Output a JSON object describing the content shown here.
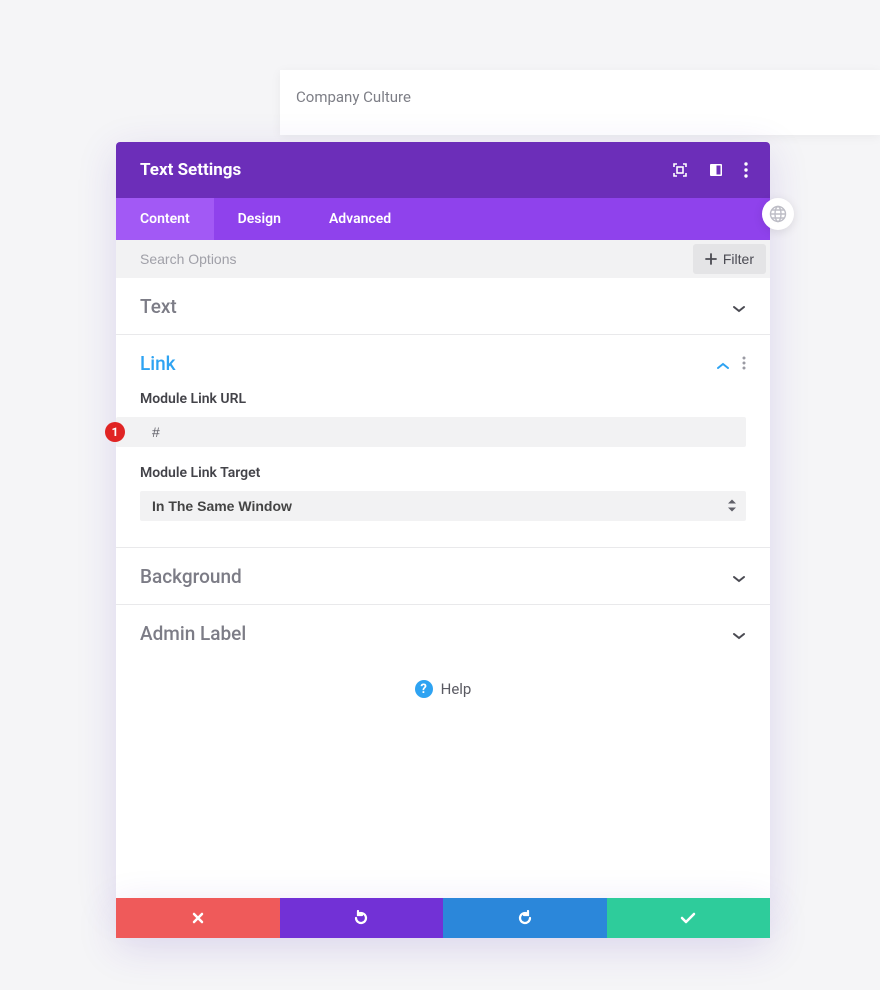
{
  "companyCulture": "Company Culture",
  "header": {
    "title": "Text Settings"
  },
  "tabs": {
    "content": "Content",
    "design": "Design",
    "advanced": "Advanced"
  },
  "search": {
    "placeholder": "Search Options",
    "filterLabel": "Filter"
  },
  "sections": {
    "text": "Text",
    "link": "Link",
    "background": "Background",
    "adminLabel": "Admin Label"
  },
  "link": {
    "urlLabel": "Module Link URL",
    "urlValue": "#",
    "urlBadge": "1",
    "targetLabel": "Module Link Target",
    "targetValue": "In The Same Window"
  },
  "help": {
    "label": "Help",
    "icon": "?"
  }
}
